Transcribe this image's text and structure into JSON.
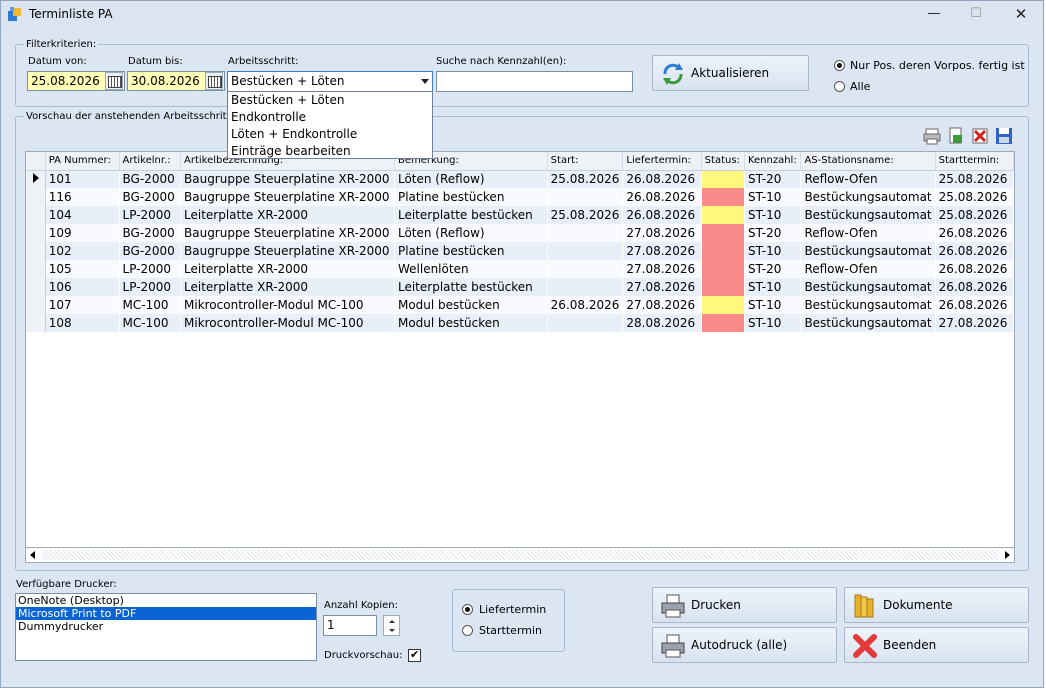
{
  "window": {
    "title": "Terminliste PA"
  },
  "filter": {
    "legend": "Filterkriterien:",
    "date_from_label": "Datum von:",
    "date_from": "25.08.2026",
    "date_to_label": "Datum bis:",
    "date_to": "30.08.2026",
    "step_label": "Arbeitsschritt:",
    "step_value": "Bestücken + Löten",
    "step_options": [
      "Bestücken + Löten",
      "Endkontrolle",
      "Löten + Endkontrolle",
      "Einträge bearbeiten"
    ],
    "search_label": "Suche nach Kennzahl(en):",
    "search_value": "",
    "refresh_label": "Aktualisieren",
    "radio_opt1": "Nur Pos. deren Vorpos. fertig ist",
    "radio_opt2": "Alle"
  },
  "preview": {
    "legend": "Vorschau der anstehenden Arbeitsschritte (",
    "columns": [
      "PA Nummer:",
      "Artikelnr.:",
      "Artikelbezeichnung:",
      "Bemerkung:",
      "Start:",
      "Liefertermin:",
      "Status:",
      "Kennzahl:",
      "AS-Stationsname:",
      "Starttermin:"
    ],
    "rows": [
      {
        "pa": "101",
        "art": "BG-2000",
        "bez": "Baugruppe Steuerplatine XR-2000",
        "bem": "Löten (Reflow)",
        "start": "25.08.2026",
        "lief": "26.08.2026",
        "status": "yellow",
        "kz": "ST-20",
        "station": "Reflow-Ofen",
        "st": "25.08.2026"
      },
      {
        "pa": "116",
        "art": "BG-2000",
        "bez": "Baugruppe Steuerplatine XR-2000",
        "bem": "Platine bestücken",
        "start": "",
        "lief": "26.08.2026",
        "status": "red",
        "kz": "ST-10",
        "station": "Bestückungsautomat",
        "st": "25.08.2026"
      },
      {
        "pa": "104",
        "art": "LP-2000",
        "bez": "Leiterplatte XR-2000",
        "bem": "Leiterplatte bestücken",
        "start": "25.08.2026",
        "lief": "26.08.2026",
        "status": "yellow",
        "kz": "ST-10",
        "station": "Bestückungsautomat",
        "st": "25.08.2026"
      },
      {
        "pa": "109",
        "art": "BG-2000",
        "bez": "Baugruppe Steuerplatine XR-2000",
        "bem": "Löten (Reflow)",
        "start": "",
        "lief": "27.08.2026",
        "status": "red",
        "kz": "ST-20",
        "station": "Reflow-Ofen",
        "st": "26.08.2026"
      },
      {
        "pa": "102",
        "art": "BG-2000",
        "bez": "Baugruppe Steuerplatine XR-2000",
        "bem": "Platine bestücken",
        "start": "",
        "lief": "27.08.2026",
        "status": "red",
        "kz": "ST-10",
        "station": "Bestückungsautomat",
        "st": "26.08.2026"
      },
      {
        "pa": "105",
        "art": "LP-2000",
        "bez": "Leiterplatte XR-2000",
        "bem": "Wellenlöten",
        "start": "",
        "lief": "27.08.2026",
        "status": "red",
        "kz": "ST-20",
        "station": "Reflow-Ofen",
        "st": "26.08.2026"
      },
      {
        "pa": "106",
        "art": "LP-2000",
        "bez": "Leiterplatte XR-2000",
        "bem": "Leiterplatte bestücken",
        "start": "",
        "lief": "27.08.2026",
        "status": "red",
        "kz": "ST-10",
        "station": "Bestückungsautomat",
        "st": "26.08.2026"
      },
      {
        "pa": "107",
        "art": "MC-100",
        "bez": "Mikrocontroller-Modul MC-100",
        "bem": "Modul bestücken",
        "start": "26.08.2026",
        "lief": "27.08.2026",
        "status": "yellow",
        "kz": "ST-10",
        "station": "Bestückungsautomat",
        "st": "26.08.2026"
      },
      {
        "pa": "108",
        "art": "MC-100",
        "bez": "Mikrocontroller-Modul MC-100",
        "bem": "Modul bestücken",
        "start": "",
        "lief": "28.08.2026",
        "status": "red",
        "kz": "ST-10",
        "station": "Bestückungsautomat",
        "st": "27.08.2026"
      }
    ],
    "status_colors": {
      "yellow": "#fff77e",
      "red": "#f98a8a"
    }
  },
  "printing": {
    "printers_label": "Verfügbare Drucker:",
    "printers": [
      "OneNote (Desktop)",
      "Microsoft Print to PDF",
      "Dummydrucker"
    ],
    "selected_printer_index": 1,
    "copies_label": "Anzahl Kopien:",
    "copies_value": "1",
    "preview_label": "Druckvorschau:",
    "sort_opt1": "Liefertermin",
    "sort_opt2": "Starttermin"
  },
  "buttons": {
    "print": "Drucken",
    "documents": "Dokumente",
    "autoprint": "Autodruck (alle)",
    "exit": "Beenden"
  }
}
